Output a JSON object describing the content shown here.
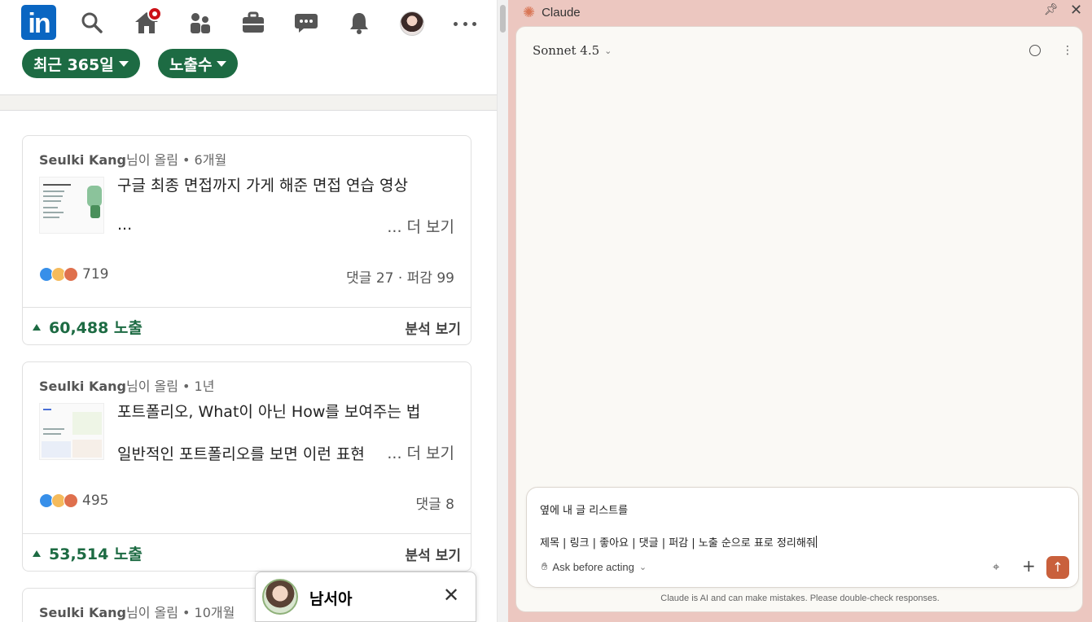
{
  "linkedin": {
    "filters": [
      {
        "label": "최근 365일"
      },
      {
        "label": "노출수"
      }
    ],
    "posts": [
      {
        "author": "Seulki Kang",
        "posted_suffix": "님이 올림 • 6개월",
        "title": "구글 최종 면접까지 가게 해준 면접 연습 영상",
        "excerpt": "...",
        "see_more": "... 더 보기",
        "reactions": "719",
        "comments": "댓글 27 · 퍼감 99",
        "impressions": "60,488 노출",
        "analyze": "분석 보기"
      },
      {
        "author": "Seulki Kang",
        "posted_suffix": "님이 올림 • 1년",
        "title": "포트폴리오, What이 아닌 How를 보여주는 법",
        "excerpt": "일반적인 포트폴리오를 보면 이런 표현",
        "see_more": "... 더 보기",
        "reactions": "495",
        "comments": "댓글 8",
        "impressions": "53,514 노출",
        "analyze": "분석 보기"
      },
      {
        "author": "Seulki Kang",
        "posted_suffix": "님이 올림 • 10개월"
      }
    ],
    "chat_popup": {
      "name": "남서아",
      "close": "✕"
    },
    "colors": {
      "brand": "#0a66c2",
      "green": "#1d6b43",
      "badge": "#cc1016"
    }
  },
  "claude": {
    "app_title": "Claude",
    "model": "Sonnet 4.5",
    "composer": {
      "line1": "옆에 내 글 리스트를",
      "line2": "제목 | 링크 | 좋아요 | 댓글 | 퍼감 | 노출 순으로 표로 정리해줘",
      "mode": "Ask before acting"
    },
    "disclaimer": "Claude is AI and can make mistakes. Please double-check responses.",
    "colors": {
      "panel": "#ecc7c0",
      "accent": "#c9603c"
    }
  }
}
